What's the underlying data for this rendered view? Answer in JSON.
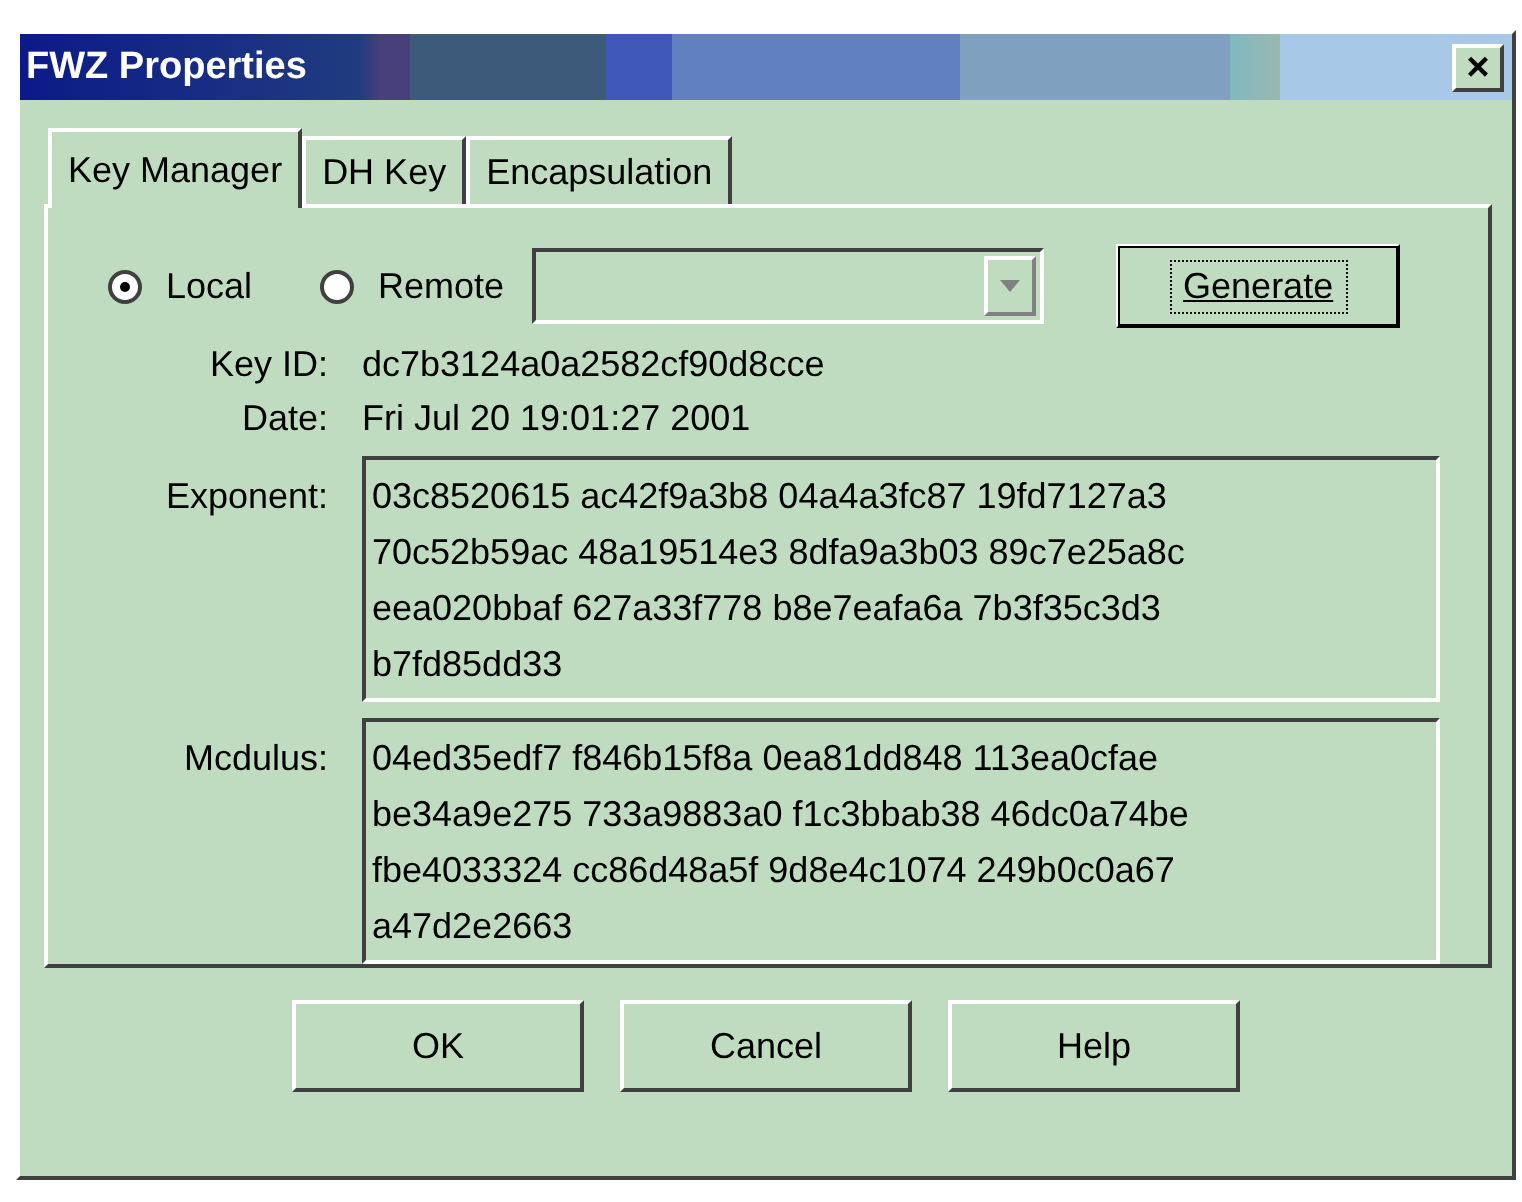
{
  "window": {
    "title": "FWZ Properties",
    "close": "×"
  },
  "tabs": [
    {
      "label": "Key Manager",
      "selected": true
    },
    {
      "label": "DH Key",
      "selected": false
    },
    {
      "label": "Encapsulation",
      "selected": false
    }
  ],
  "source": [
    {
      "label": "Local",
      "selected": true
    },
    {
      "label": "Remote",
      "selected": false
    }
  ],
  "remote_dropdown": {
    "disabled": true
  },
  "generate_button": {
    "label": "Generate",
    "focused": true
  },
  "fields": [
    {
      "kind": "text",
      "label": "Key ID:",
      "value": "dc7b3124a0a2582cf90d8cce"
    },
    {
      "kind": "text",
      "label": "Date:",
      "value": "Fri Jul 20 19:01:27 2001"
    },
    {
      "kind": "box",
      "label": "Exponent:",
      "lines": [
        "03c8520615 ac42f9a3b8 04a4a3fc87 19fd7127a3",
        "70c52b59ac 48a19514e3 8dfa9a3b03 89c7e25a8c",
        "eea020bbaf 627a33f778 b8e7eafa6a 7b3f35c3d3",
        "b7fd85dd33"
      ]
    },
    {
      "kind": "box",
      "label": "Mcdulus:",
      "lines": [
        "04ed35edf7 f846b15f8a 0ea81dd848 113ea0cfae",
        "be34a9e275 733a9883a0 f1c3bbab38 46dc0a74be",
        "fbe4033324 cc86d48a5f 9d8e4c1074 249b0c0a67",
        "a47d2e2663"
      ]
    }
  ],
  "buttons": [
    "OK",
    "Cancel",
    "Help"
  ]
}
